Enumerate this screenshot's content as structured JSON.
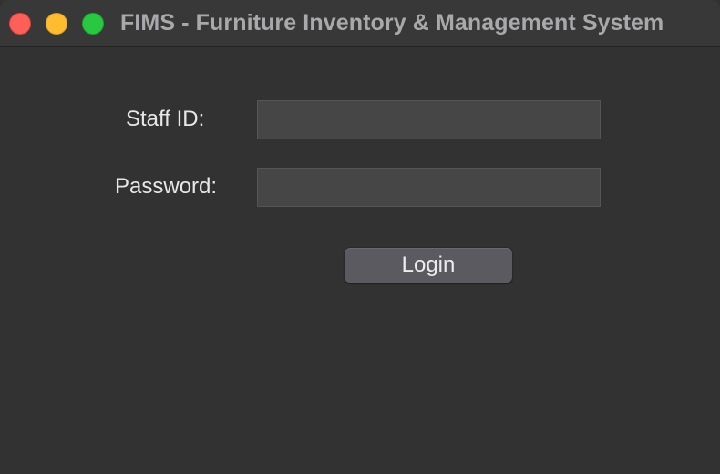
{
  "window": {
    "title": "FIMS - Furniture Inventory & Management System",
    "controls": [
      "close",
      "minimize",
      "maximize"
    ],
    "colors": {
      "background": "#323232",
      "titlebar": "#383838",
      "close": "#fe5f57",
      "minimize": "#febc2e",
      "maximize": "#28c840"
    }
  },
  "form": {
    "staff_id_label": "Staff ID:",
    "staff_id_value": "",
    "password_label": "Password:",
    "password_value": "",
    "login_label": "Login"
  }
}
